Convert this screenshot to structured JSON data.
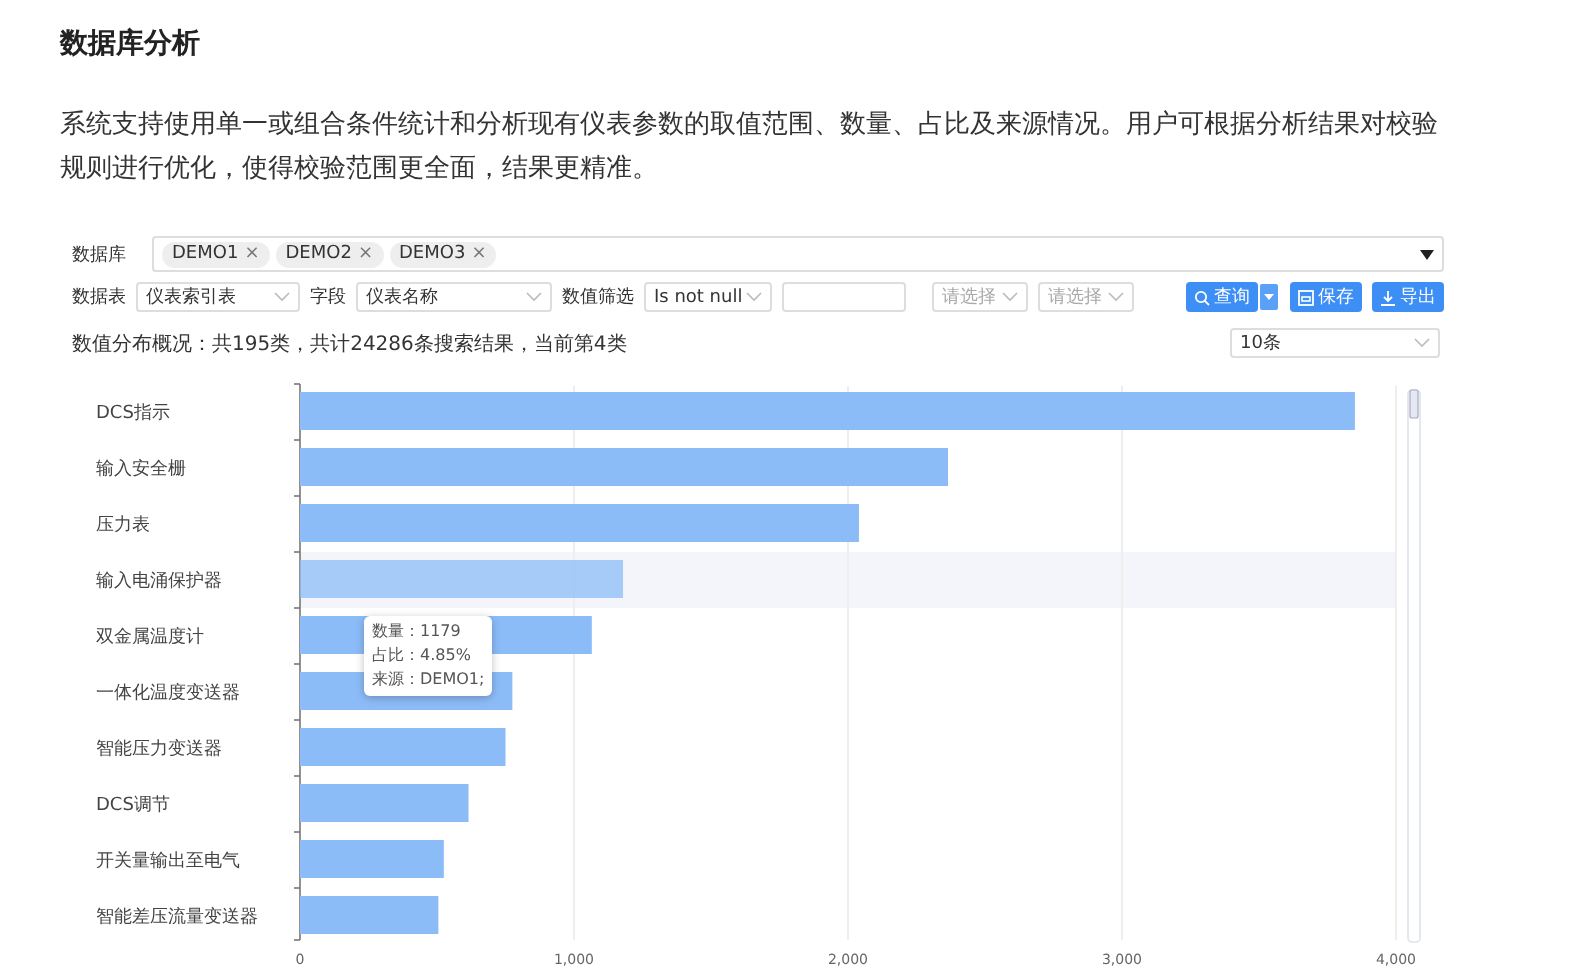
{
  "page": {
    "title": "数据库分析",
    "description": "系统支持使用单一或组合条件统计和分析现有仪表参数的取值范围、数量、占比及来源情况。用户可根据分析结果对校验规则进行优化，使得校验范围更全面，结果更精准。"
  },
  "panel": {
    "database": {
      "label": "数据库",
      "tags": [
        {
          "label": "DEMO1",
          "remove": "×"
        },
        {
          "label": "DEMO2",
          "remove": "×"
        },
        {
          "label": "DEMO3",
          "remove": "×"
        }
      ]
    },
    "filters": {
      "table_label": "数据表",
      "table_value": "仪表索引表",
      "field_label": "字段",
      "field_value": "仪表名称",
      "value_filter_label": "数值筛选",
      "operator_value": "Is not null",
      "select_1_placeholder": "请选择",
      "select_2_placeholder": "请选择"
    },
    "buttons": [
      {
        "kind": "query",
        "label": "查询"
      },
      {
        "kind": "save",
        "label": "保存"
      },
      {
        "kind": "export",
        "label": "导出"
      }
    ],
    "summary": "数值分布概况：共195类，共计24286条搜索结果，当前第4类",
    "page_size": "10条",
    "chart": {
      "hovered": [
        false,
        false,
        false,
        true,
        false,
        false,
        false,
        false,
        false,
        false
      ],
      "tooltip": [
        "数量：1179",
        "占比：4.85%",
        "来源：DEMO1;"
      ],
      "chart_data": {
        "type": "bar",
        "orientation": "horizontal",
        "categories": [
          "DCS指示",
          "输入安全栅",
          "压力表",
          "输入电涌保护器",
          "双金属温度计",
          "一体化温度变送器",
          "智能压力变送器",
          "DCS调节",
          "开关量输出至电气",
          "智能差压流量变送器"
        ],
        "grid": true,
        "series": [
          {
            "color": "#8cbcf8",
            "values": [
              3850,
              2365,
              2040,
              1179,
              1065,
              775,
              750,
              615,
              525,
              505
            ]
          }
        ],
        "xlim": [
          0,
          4000
        ],
        "xticks": [
          {
            "value": 0,
            "label": "0"
          },
          {
            "value": 1000,
            "label": "1,000"
          },
          {
            "value": 2000,
            "label": "2,000"
          },
          {
            "value": 3000,
            "label": "3,000"
          },
          {
            "value": 4000,
            "label": "4,000"
          }
        ]
      }
    }
  }
}
